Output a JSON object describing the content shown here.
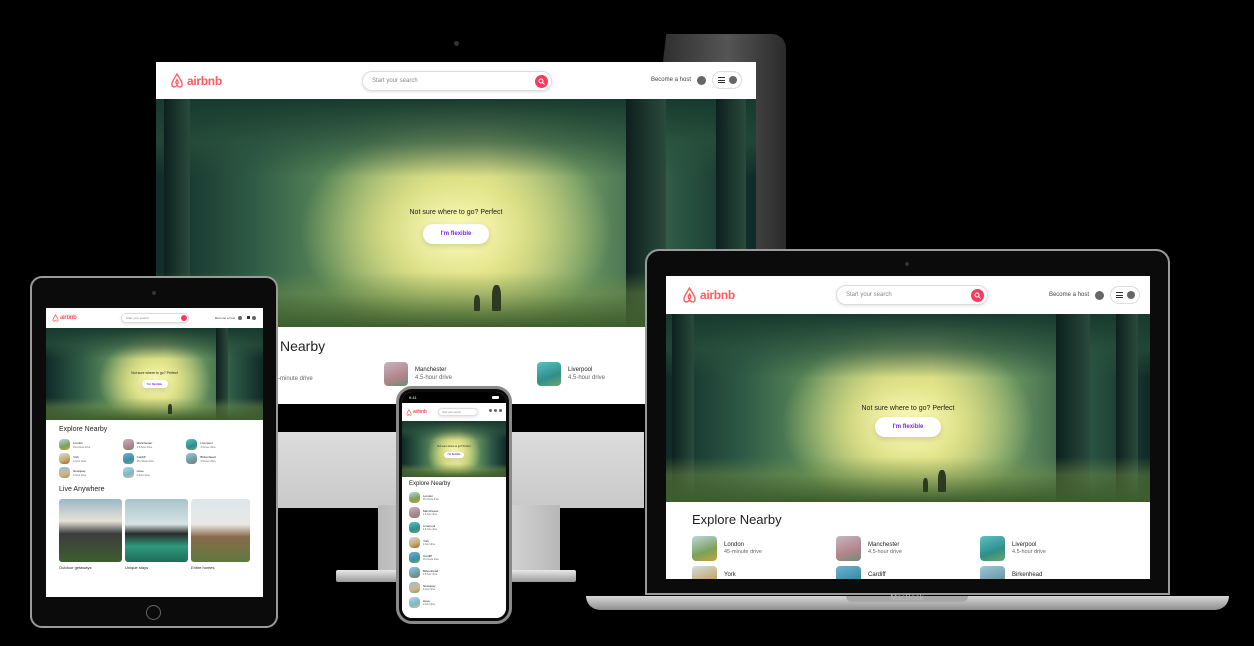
{
  "site": {
    "logo_text": "airbnb",
    "search_placeholder": "Start your search",
    "become_host": "Become a host",
    "hero_text": "Not sure where to go? Perfect",
    "flexible_button": "I'm flexible",
    "explore_title": "Explore Nearby",
    "explore_title_partial": "Nearby",
    "live_title": "Live Anywhere",
    "destinations": [
      {
        "name": "London",
        "time": "45-minute drive"
      },
      {
        "name": "Manchester",
        "time": "4.5-hour drive"
      },
      {
        "name": "Liverpool",
        "time": "4.5-hour drive"
      },
      {
        "name": "York",
        "time": "4-hour drive"
      },
      {
        "name": "Cardiff",
        "time": "45-minute drive"
      },
      {
        "name": "Birkenhead",
        "time": "4.5-hour drive"
      },
      {
        "name": "Newquay",
        "time": "6-hour drive"
      },
      {
        "name": "Hove",
        "time": "2-hour drive"
      }
    ],
    "live_items": [
      {
        "label": "Outdoor getaways"
      },
      {
        "label": "Unique stays"
      },
      {
        "label": "Entire homes"
      }
    ]
  },
  "imac": {
    "partial_card_times": [
      "-minute drive"
    ]
  },
  "phone": {
    "time": "9:41"
  },
  "laptop": {
    "brand": "MacBook"
  },
  "colors": {
    "brand": "#ff5a5f",
    "flexible": "#7c2ae8",
    "background": "#000000"
  }
}
